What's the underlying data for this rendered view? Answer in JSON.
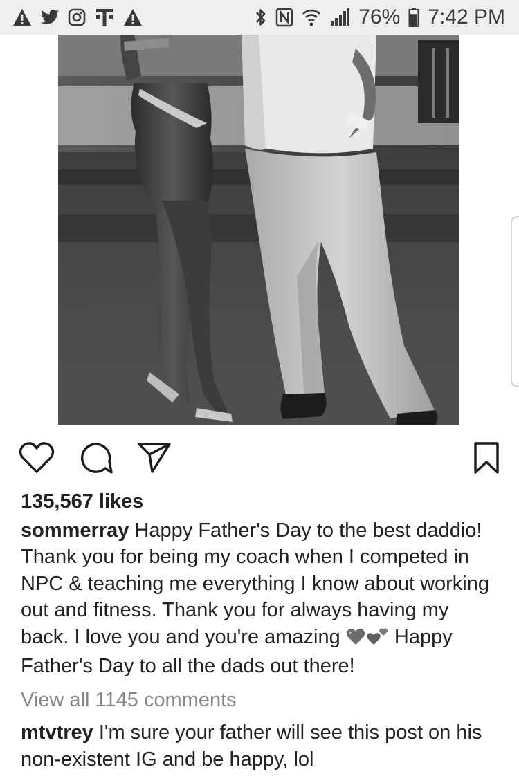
{
  "status_bar": {
    "left_icons": [
      "warning-icon",
      "twitter-icon",
      "instagram-icon",
      "t-mobile-icon",
      "warning-icon"
    ],
    "right_icons": [
      "bluetooth-icon",
      "nfc-icon",
      "wifi-icon",
      "signal-icon"
    ],
    "battery_percent": "76%",
    "battery_level": 0.76,
    "time": "7:42 PM"
  },
  "post": {
    "actions": [
      "heart-icon",
      "comment-icon",
      "share-icon",
      "bookmark-icon"
    ],
    "likes": "135,567 likes",
    "caption": {
      "username": "sommerray",
      "text_1": "Happy Father's Day to the best daddio! Thank you for being my coach when I competed in NPC & teaching me everything I know about working out and fitness. Thank you for always having my back. I love you and you're amazing",
      "emojis": [
        "grey-heart-emoji",
        "two-hearts-emoji"
      ],
      "text_2": "Happy Father's Day to all the dads out there!"
    },
    "view_comments": "View all 1145 comments",
    "comment": {
      "username": "mtvtrey",
      "text": "I'm sure your father will see this post on his non-existent IG and be happy, lol"
    }
  }
}
